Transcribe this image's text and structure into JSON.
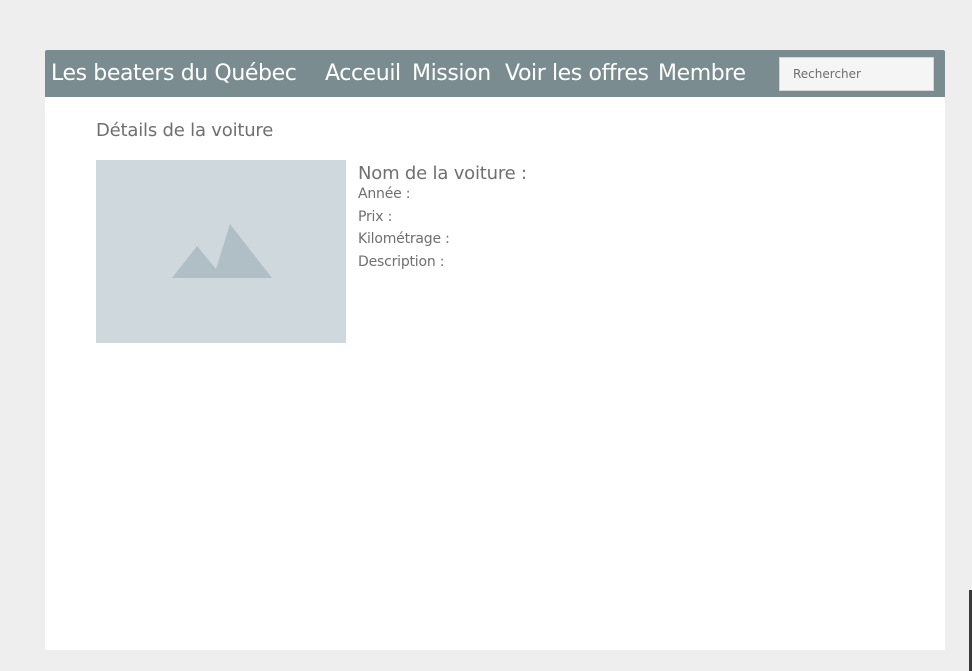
{
  "navbar": {
    "brand": "Les beaters du Québec",
    "links": [
      "Acceuil",
      "Mission",
      "Voir les offres",
      "Membre"
    ],
    "search": {
      "placeholder": "Rechercher",
      "value": ""
    },
    "background_color": "#7a8c8f"
  },
  "page": {
    "section_title": "Détails de la voiture",
    "image_icon": "mountain-image-placeholder-icon",
    "car": {
      "name_label": "Nom de la voiture :",
      "year_label": "Année :",
      "price_label": "Prix :",
      "mileage_label": "Kilométrage :",
      "description_label": "Description :"
    }
  }
}
